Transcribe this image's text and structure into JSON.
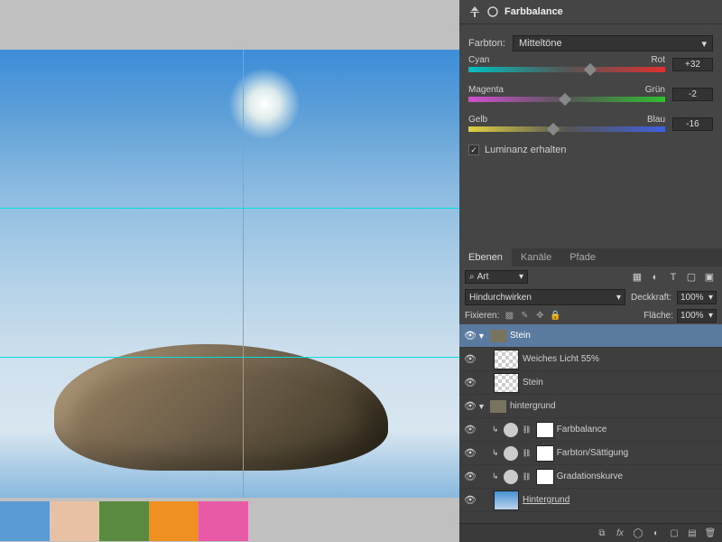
{
  "canvas": {
    "guides": {
      "h1": 175,
      "h2": 340,
      "v1": 269
    }
  },
  "swatches": [
    "#5b9bd5",
    "#e8c0a3",
    "#5a8a3f",
    "#f09020",
    "#e85aa5"
  ],
  "colorBalance": {
    "title": "Farbbalance",
    "toneLabel": "Farbton:",
    "toneValue": "Mitteltöne",
    "sliders": [
      {
        "left": "Cyan",
        "right": "Rot",
        "value": "+32",
        "pos": 62,
        "gradient": "linear-gradient(to right,#00c0c0,#555,#e03030)"
      },
      {
        "left": "Magenta",
        "right": "Grün",
        "value": "-2",
        "pos": 49,
        "gradient": "linear-gradient(to right,#d050d0,#555,#30c030)"
      },
      {
        "left": "Gelb",
        "right": "Blau",
        "value": "-16",
        "pos": 43,
        "gradient": "linear-gradient(to right,#e0d040,#555,#4060e0)"
      }
    ],
    "preserveLum": "Luminanz erhalten",
    "preserveLumChecked": true
  },
  "layersPanel": {
    "tabs": [
      "Ebenen",
      "Kanäle",
      "Pfade"
    ],
    "activeTab": 0,
    "searchLabel": "Art",
    "blendMode": "Hindurchwirken",
    "opacityLabel": "Deckkraft:",
    "opacityValue": "100%",
    "fillLabel": "Fläche:",
    "fillValue": "100%",
    "lockLabel": "Fixieren:",
    "layers": [
      {
        "type": "group",
        "indent": 0,
        "name": "Stein",
        "selected": true,
        "open": true
      },
      {
        "type": "layer",
        "indent": 1,
        "name": "Weiches Licht 55%",
        "thumb": "checker"
      },
      {
        "type": "layer",
        "indent": 1,
        "name": "Stein",
        "thumb": "checker"
      },
      {
        "type": "group",
        "indent": 0,
        "name": "hintergrund",
        "open": true
      },
      {
        "type": "adj",
        "indent": 1,
        "name": "Farbbalance",
        "clipped": true
      },
      {
        "type": "adj",
        "indent": 1,
        "name": "Farbton/Sättigung",
        "clipped": true
      },
      {
        "type": "adj",
        "indent": 1,
        "name": "Gradationskurve",
        "clipped": true
      },
      {
        "type": "layer",
        "indent": 1,
        "name": "Hintergrund",
        "thumb": "sky",
        "underline": true
      }
    ]
  }
}
